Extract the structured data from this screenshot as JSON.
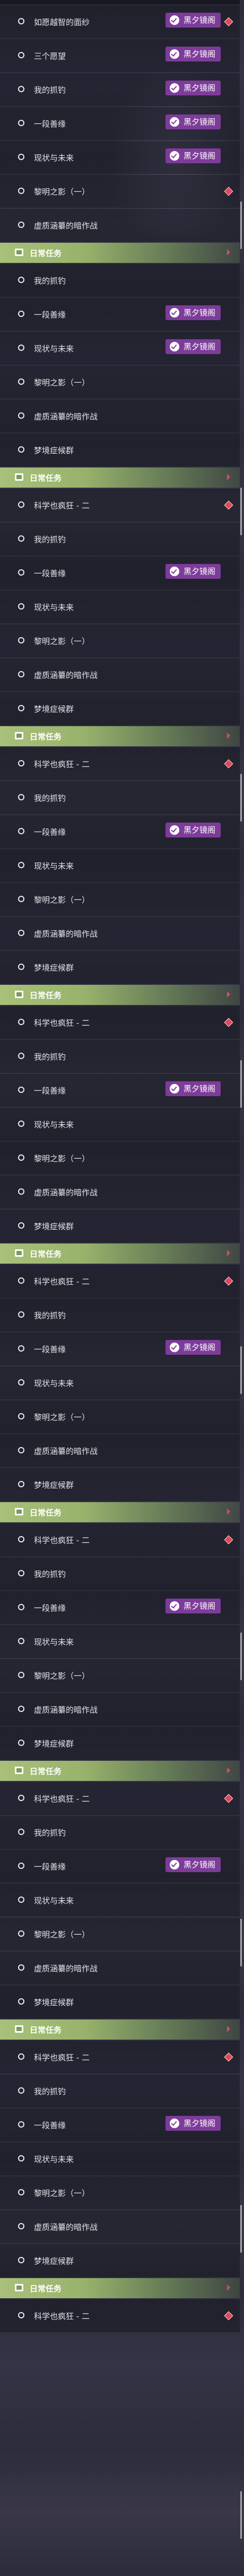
{
  "badge_label": "黑夕镜阁",
  "section_header": "日常任务",
  "colors": {
    "badge": "#7d3c9a",
    "header": "#a8c07a",
    "diamond": "#e0475a"
  },
  "rows": [
    {
      "label": "如愿越智的面纱",
      "badge": true,
      "diamond": true
    },
    {
      "label": "三个愿望",
      "badge": true
    },
    {
      "label": "我的抓钓",
      "badge": true
    },
    {
      "label": "一段善缘",
      "badge": true
    },
    {
      "label": "现状与未来",
      "badge": true
    },
    {
      "label": "黎明之影（一）",
      "diamond": true
    },
    {
      "label": "虚质涵纂的暗作战"
    },
    {
      "header": true
    },
    {
      "label": "我的抓钓"
    },
    {
      "label": "一段善缘",
      "badge": true
    },
    {
      "label": "现状与未来",
      "badge": true
    },
    {
      "label": "黎明之影（一）"
    },
    {
      "label": "虚质涵纂的暗作战"
    },
    {
      "label": "梦境症候群"
    },
    {
      "header": true
    },
    {
      "label": "科学也疯狂 - 二",
      "diamond": true
    },
    {
      "label": "我的抓钓"
    },
    {
      "label": "一段善缘",
      "badge": true
    },
    {
      "label": "现状与未来"
    },
    {
      "label": "黎明之影（一）"
    },
    {
      "label": "虚质涵纂的暗作战"
    },
    {
      "label": "梦境症候群"
    },
    {
      "header": true
    },
    {
      "label": "科学也疯狂 - 二",
      "diamond": true
    },
    {
      "label": "我的抓钓"
    },
    {
      "label": "一段善缘",
      "badge": true
    },
    {
      "label": "现状与未来"
    },
    {
      "label": "黎明之影（一）"
    },
    {
      "label": "虚质涵纂的暗作战"
    },
    {
      "label": "梦境症候群"
    },
    {
      "header": true
    },
    {
      "label": "科学也疯狂 - 二",
      "diamond": true
    },
    {
      "label": "我的抓钓"
    },
    {
      "label": "一段善缘",
      "badge": true
    },
    {
      "label": "现状与未来"
    },
    {
      "label": "黎明之影（一）"
    },
    {
      "label": "虚质涵纂的暗作战"
    },
    {
      "label": "梦境症候群"
    },
    {
      "header": true
    },
    {
      "label": "科学也疯狂 - 二",
      "diamond": true
    },
    {
      "label": "我的抓钓"
    },
    {
      "label": "一段善缘",
      "badge": true
    },
    {
      "label": "现状与未来"
    },
    {
      "label": "黎明之影（一）"
    },
    {
      "label": "虚质涵纂的暗作战"
    },
    {
      "label": "梦境症候群"
    },
    {
      "header": true
    },
    {
      "label": "科学也疯狂 - 二",
      "diamond": true
    },
    {
      "label": "我的抓钓"
    },
    {
      "label": "一段善缘",
      "badge": true
    },
    {
      "label": "现状与未来"
    },
    {
      "label": "黎明之影（一）"
    },
    {
      "label": "虚质涵纂的暗作战"
    },
    {
      "label": "梦境症候群"
    },
    {
      "header": true
    },
    {
      "label": "科学也疯狂 - 二",
      "diamond": true
    },
    {
      "label": "我的抓钓"
    },
    {
      "label": "一段善缘",
      "badge": true
    },
    {
      "label": "现状与未来"
    },
    {
      "label": "黎明之影（一）"
    },
    {
      "label": "虚质涵纂的暗作战"
    },
    {
      "label": "梦境症候群"
    },
    {
      "header": true
    },
    {
      "label": "科学也疯狂 - 二",
      "diamond": true
    },
    {
      "label": "我的抓钓"
    },
    {
      "label": "一段善缘",
      "badge": true
    },
    {
      "label": "现状与未来"
    },
    {
      "label": "黎明之影（一）"
    },
    {
      "label": "虚质涵纂的暗作战"
    },
    {
      "label": "梦境症候群"
    },
    {
      "header": true
    },
    {
      "label": "科学也疯狂 - 二",
      "diamond": true
    }
  ]
}
